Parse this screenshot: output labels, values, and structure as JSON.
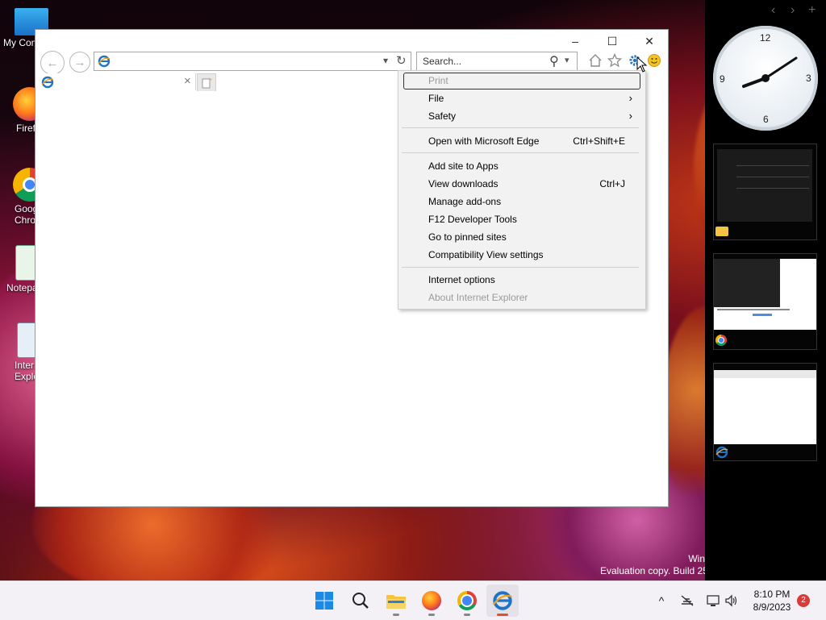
{
  "desktop": {
    "icons": [
      {
        "label": "My Con"
      },
      {
        "label": "Firef"
      },
      {
        "label": "Goog\nChro"
      },
      {
        "label": "Notepa"
      },
      {
        "label": "Intern\nExplo"
      }
    ],
    "watermark": {
      "line1": "Win",
      "line2": "Evaluation copy. Build 25"
    }
  },
  "ie": {
    "caption": {
      "minimize": "–",
      "maximize": "☐",
      "close": "✕"
    },
    "nav": {
      "back": "←",
      "forward": "→"
    },
    "address": {
      "value": "",
      "dropdown": "▾",
      "refresh": "↻"
    },
    "search": {
      "placeholder": "Search...",
      "icon": "⚲",
      "dropdown": "▾"
    },
    "tab": {
      "title": "",
      "close": "×"
    },
    "toolbar_icons": [
      "home-icon",
      "favorites-star-icon",
      "tools-gear-icon",
      "feedback-smiley-icon"
    ]
  },
  "tools_menu": {
    "items": [
      {
        "label": "Print",
        "shortcut": "",
        "submenu": false,
        "disabled": true
      },
      {
        "label": "File",
        "shortcut": "",
        "submenu": true,
        "disabled": false
      },
      {
        "label": "Safety",
        "shortcut": "",
        "submenu": true,
        "disabled": false
      },
      {
        "label": "Open with Microsoft Edge",
        "shortcut": "Ctrl+Shift+E",
        "submenu": false,
        "disabled": false
      },
      {
        "label": "Add site to Apps",
        "shortcut": "",
        "submenu": false,
        "disabled": false
      },
      {
        "label": "View downloads",
        "shortcut": "Ctrl+J",
        "submenu": false,
        "disabled": false
      },
      {
        "label": "Manage add-ons",
        "shortcut": "",
        "submenu": false,
        "disabled": false
      },
      {
        "label": "F12 Developer Tools",
        "shortcut": "",
        "submenu": false,
        "disabled": false
      },
      {
        "label": "Go to pinned sites",
        "shortcut": "",
        "submenu": false,
        "disabled": false
      },
      {
        "label": "Compatibility View settings",
        "shortcut": "",
        "submenu": false,
        "disabled": false
      },
      {
        "label": "Internet options",
        "shortcut": "",
        "submenu": false,
        "disabled": false
      },
      {
        "label": "About Internet Explorer",
        "shortcut": "",
        "submenu": false,
        "disabled": true
      }
    ],
    "submenu_arrow": "›"
  },
  "panel": {
    "nav_prev": "‹",
    "nav_next": "›",
    "clock": {
      "n12": "12",
      "n3": "3",
      "n6": "6",
      "n9": "9"
    },
    "thumbnails": [
      "file-explorer",
      "chrome",
      "internet-explorer"
    ]
  },
  "taskbar": {
    "apps": [
      "start",
      "search",
      "file-explorer",
      "firefox",
      "chrome",
      "internet-explorer"
    ],
    "tray": {
      "time": "8:10 PM",
      "date": "8/9/2023",
      "notifications": "2",
      "chevron": "^"
    }
  },
  "colors": {
    "ie_blue": "#1e73c8",
    "ie_orange": "#f0a01e",
    "taskbar_bg": "#f3f1f5",
    "menu_bg": "#f2f2f2",
    "badge_red": "#d93a3a"
  }
}
